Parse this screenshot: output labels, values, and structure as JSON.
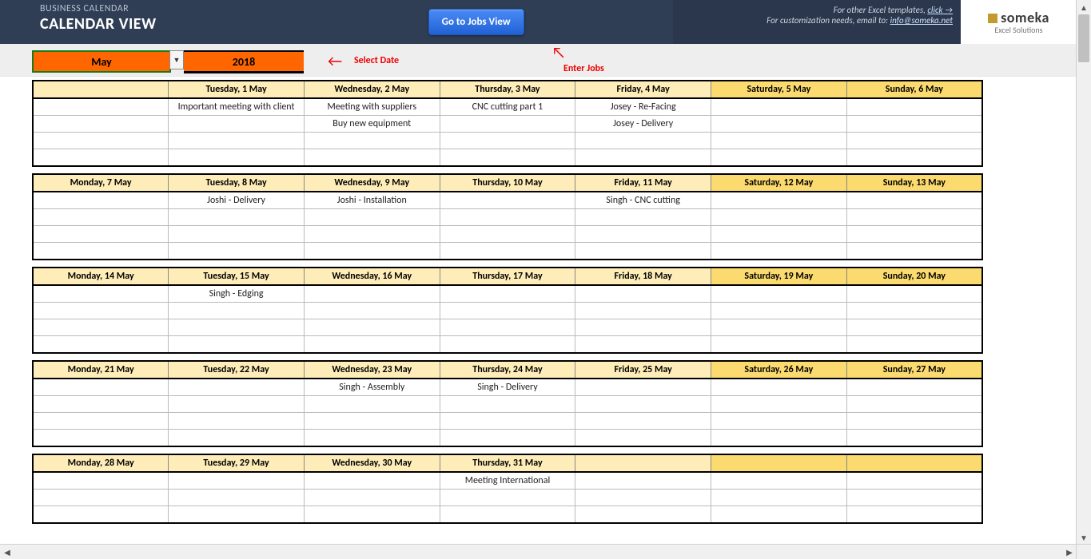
{
  "header": {
    "subtitle": "BUSINESS CALENDAR",
    "title": "CALENDAR VIEW",
    "go_button": "Go to Jobs View",
    "templates_text": "For other Excel templates,",
    "templates_link": "click →",
    "customize_text": "For customization needs, email to:",
    "customize_email": "info@someka.net",
    "logo_brand": "someka",
    "logo_tag": "Excel Solutions"
  },
  "datebar": {
    "month": "May",
    "year": "2018",
    "select_hint": "Select Date",
    "enter_hint": "Enter Jobs"
  },
  "calendar": {
    "weeks": [
      {
        "headers": [
          "",
          "Tuesday, 1 May",
          "Wednesday, 2 May",
          "Thursday, 3 May",
          "Friday, 4 May",
          "Saturday, 5 May",
          "Sunday, 6 May"
        ],
        "rows": [
          [
            "",
            "Important meeting with client",
            "Meeting with suppliers",
            "CNC cutting part 1",
            "Josey - Re-Facing",
            "",
            ""
          ],
          [
            "",
            "",
            "Buy new equipment",
            "",
            "Josey - Delivery",
            "",
            ""
          ],
          [
            "",
            "",
            "",
            "",
            "",
            "",
            ""
          ],
          [
            "",
            "",
            "",
            "",
            "",
            "",
            ""
          ]
        ]
      },
      {
        "headers": [
          "Monday, 7 May",
          "Tuesday, 8 May",
          "Wednesday, 9 May",
          "Thursday, 10 May",
          "Friday, 11 May",
          "Saturday, 12 May",
          "Sunday, 13 May"
        ],
        "rows": [
          [
            "",
            "Joshi - Delivery",
            "Joshi - Installation",
            "",
            "Singh - CNC cutting",
            "",
            ""
          ],
          [
            "",
            "",
            "",
            "",
            "",
            "",
            ""
          ],
          [
            "",
            "",
            "",
            "",
            "",
            "",
            ""
          ],
          [
            "",
            "",
            "",
            "",
            "",
            "",
            ""
          ]
        ]
      },
      {
        "headers": [
          "Monday, 14 May",
          "Tuesday, 15 May",
          "Wednesday, 16 May",
          "Thursday, 17 May",
          "Friday, 18 May",
          "Saturday, 19 May",
          "Sunday, 20 May"
        ],
        "rows": [
          [
            "",
            "Singh - Edging",
            "",
            "",
            "",
            "",
            ""
          ],
          [
            "",
            "",
            "",
            "",
            "",
            "",
            ""
          ],
          [
            "",
            "",
            "",
            "",
            "",
            "",
            ""
          ],
          [
            "",
            "",
            "",
            "",
            "",
            "",
            ""
          ]
        ]
      },
      {
        "headers": [
          "Monday, 21 May",
          "Tuesday, 22 May",
          "Wednesday, 23 May",
          "Thursday, 24 May",
          "Friday, 25 May",
          "Saturday, 26 May",
          "Sunday, 27 May"
        ],
        "rows": [
          [
            "",
            "",
            "Singh - Assembly",
            "Singh - Delivery",
            "",
            "",
            ""
          ],
          [
            "",
            "",
            "",
            "",
            "",
            "",
            ""
          ],
          [
            "",
            "",
            "",
            "",
            "",
            "",
            ""
          ],
          [
            "",
            "",
            "",
            "",
            "",
            "",
            ""
          ]
        ]
      },
      {
        "headers": [
          "Monday, 28 May",
          "Tuesday, 29 May",
          "Wednesday, 30 May",
          "Thursday, 31 May",
          "",
          "",
          ""
        ],
        "rows": [
          [
            "",
            "",
            "",
            "Meeting International",
            "",
            "",
            ""
          ],
          [
            "",
            "",
            "",
            "",
            "",
            "",
            ""
          ],
          [
            "",
            "",
            "",
            "",
            "",
            "",
            ""
          ]
        ]
      }
    ]
  }
}
